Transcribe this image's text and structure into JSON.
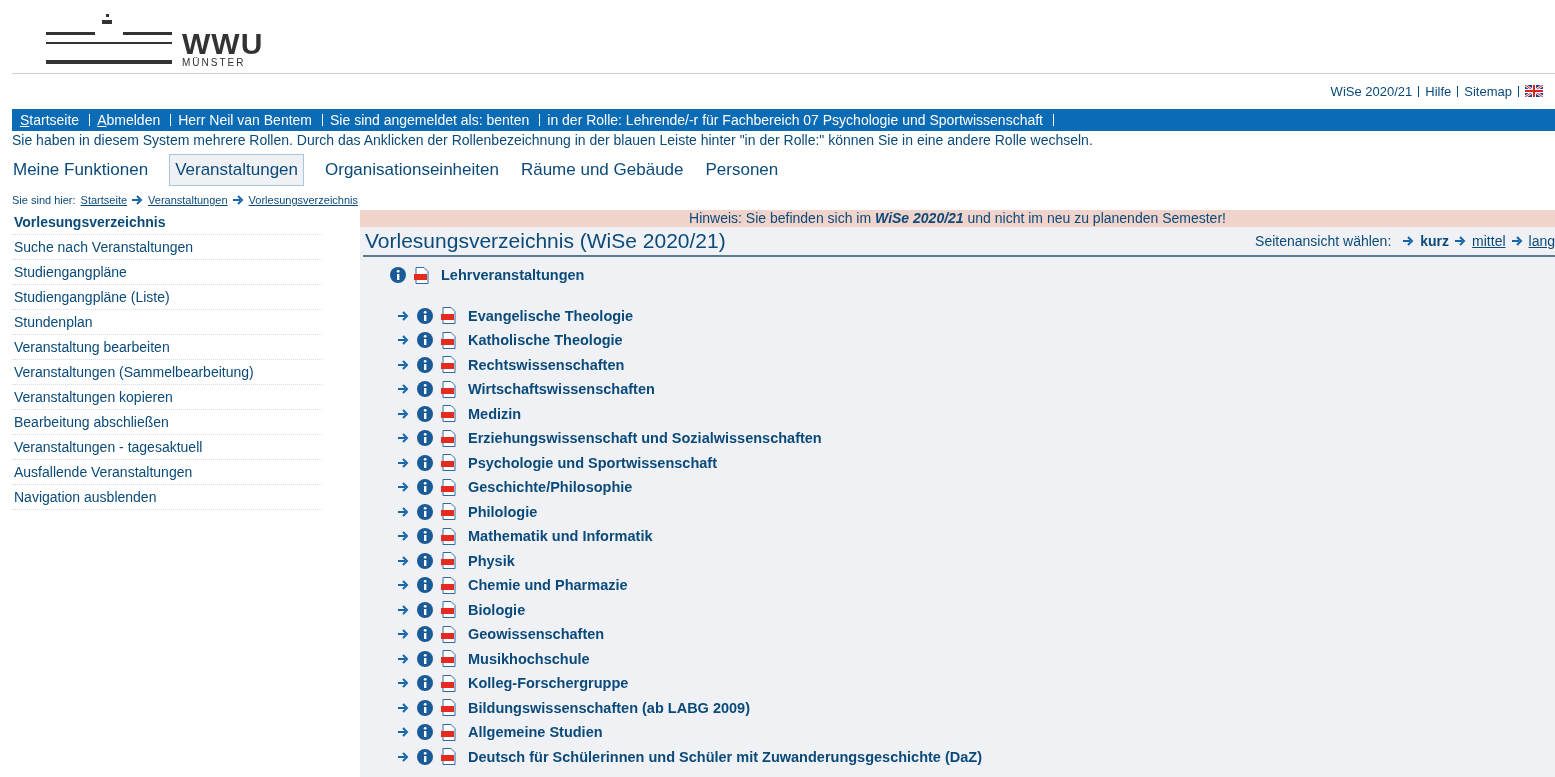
{
  "logo": {
    "wordmark": "WWU",
    "subtitle": "MÜNSTER"
  },
  "service_links": [
    {
      "label": "WiSe 2020/21"
    },
    {
      "label": "Hilfe"
    },
    {
      "label": "Sitemap"
    }
  ],
  "user_bar": [
    {
      "label": "Startseite",
      "accesskey": true
    },
    {
      "label": "Abmelden",
      "accesskey": true
    },
    {
      "label": "Herr Neil van Bentem",
      "accesskey": false
    },
    {
      "label": "Sie sind angemeldet als: benten",
      "accesskey": false
    },
    {
      "label": "in der Rolle: Lehrende/-r für  Fachbereich 07 Psychologie und Sportwissenschaft",
      "accesskey": false
    }
  ],
  "role_hint": "Sie haben in diesem System mehrere Rollen. Durch das Anklicken der Rollenbezeichnung in der blauen Leiste hinter \"in der Rolle:\" können Sie in eine andere Rolle wechseln.",
  "main_nav": [
    {
      "label": "Meine Funktionen",
      "selected": false
    },
    {
      "label": "Veranstaltungen",
      "selected": true
    },
    {
      "label": "Organisationseinheiten",
      "selected": false
    },
    {
      "label": "Räume und Gebäude",
      "selected": false
    },
    {
      "label": "Personen",
      "selected": false
    }
  ],
  "breadcrumb": {
    "prefix": "Sie sind hier:",
    "items": [
      "Startseite",
      "Veranstaltungen",
      "Vorlesungsverzeichnis"
    ]
  },
  "sidebar": {
    "items": [
      {
        "label": "Vorlesungsverzeichnis",
        "selected": true
      },
      {
        "label": "Suche nach Veranstaltungen",
        "selected": false
      },
      {
        "label": "Studiengangpläne",
        "selected": false
      },
      {
        "label": "Studiengangpläne (Liste)",
        "selected": false
      },
      {
        "label": "Stundenplan",
        "selected": false
      },
      {
        "label": "Veranstaltung bearbeiten",
        "selected": false
      },
      {
        "label": "Veranstaltungen (Sammelbearbeitung)",
        "selected": false
      },
      {
        "label": "Veranstaltungen kopieren",
        "selected": false
      },
      {
        "label": "Bearbeitung abschließen",
        "selected": false
      },
      {
        "label": "Veranstaltungen - tagesaktuell",
        "selected": false
      },
      {
        "label": "Ausfallende Veranstaltungen",
        "selected": false
      },
      {
        "label": "Navigation ausblenden",
        "selected": false
      }
    ]
  },
  "notice": "Hinweis: Sie befinden sich im **WiSe 2020/21** und nicht im neu zu planenden Semester!",
  "content": {
    "title": "Vorlesungsverzeichnis (WiSe 2020/21)",
    "view_label": "Seitenansicht wählen:",
    "views": [
      {
        "label": "kurz",
        "selected": true
      },
      {
        "label": "mittel",
        "selected": false
      },
      {
        "label": "lang",
        "selected": false
      }
    ],
    "tree": [
      {
        "label": "Lehrveranstaltungen",
        "children": [
          {
            "label": "Evangelische Theologie"
          },
          {
            "label": "Katholische Theologie"
          },
          {
            "label": "Rechtswissenschaften"
          },
          {
            "label": "Wirtschaftswissenschaften"
          },
          {
            "label": "Medizin"
          },
          {
            "label": "Erziehungswissenschaft und Sozialwissenschaften"
          },
          {
            "label": "Psychologie und Sportwissenschaft"
          },
          {
            "label": "Geschichte/Philosophie"
          },
          {
            "label": "Philologie"
          },
          {
            "label": "Mathematik und Informatik"
          },
          {
            "label": "Physik"
          },
          {
            "label": "Chemie und Pharmazie"
          },
          {
            "label": "Biologie"
          },
          {
            "label": "Geowissenschaften"
          },
          {
            "label": "Musikhochschule"
          },
          {
            "label": "Kolleg-Forschergruppe"
          },
          {
            "label": "Bildungswissenschaften (ab LABG 2009)"
          },
          {
            "label": "Allgemeine Studien"
          },
          {
            "label": "Deutsch für Schülerinnen und Schüler mit Zuwanderungsgeschichte (DaZ)"
          }
        ]
      }
    ]
  }
}
